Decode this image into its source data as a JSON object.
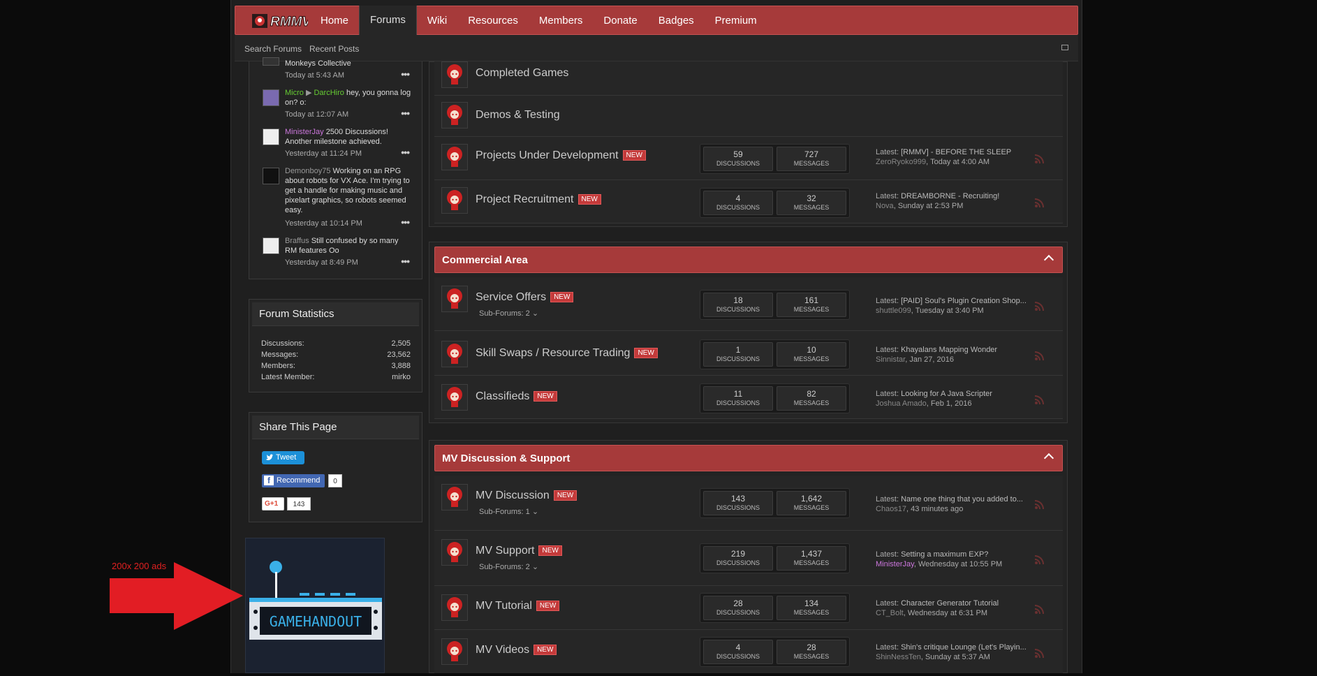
{
  "topnav": {
    "logo_text": "RMMV",
    "items": [
      "Home",
      "Forums",
      "Wiki",
      "Resources",
      "Members",
      "Donate",
      "Badges",
      "Premium"
    ],
    "active": "Forums"
  },
  "subnav": {
    "search": "Search Forums",
    "recent": "Recent Posts"
  },
  "profile_posts": [
    {
      "user": "",
      "target": "",
      "text": "Monkeys Collective",
      "time": "Today at 5:43 AM"
    },
    {
      "user": "Micro",
      "target": "DarcHiro",
      "text": "hey, you gonna log on? o:",
      "time": "Today at 12:07 AM"
    },
    {
      "user": "MinisterJay",
      "target": "",
      "text": "2500 Discussions! Another milestone achieved.",
      "time": "Yesterday at 11:24 PM"
    },
    {
      "user": "Demonboy75",
      "target": "",
      "text": "Working on an RPG about robots for VX Ace. I'm trying to get a handle for making music and pixelart graphics, so robots seemed easy.",
      "time": "Yesterday at 10:14 PM"
    },
    {
      "user": "Braffus",
      "target": "",
      "text": "Still confused by so many RM features Oo",
      "time": "Yesterday at 8:49 PM"
    }
  ],
  "colors": {
    "micro": "#66cc33",
    "darchiro": "#66cc33",
    "ministerjay": "#cc77dd",
    "demonboy": "#999999",
    "braffus": "#999999",
    "accent": "#a63a3a"
  },
  "forum_stats": {
    "title": "Forum Statistics",
    "rows": [
      {
        "label": "Discussions:",
        "value": "2,505"
      },
      {
        "label": "Messages:",
        "value": "23,562"
      },
      {
        "label": "Members:",
        "value": "3,888"
      },
      {
        "label": "Latest Member:",
        "value": "mirko"
      }
    ]
  },
  "share": {
    "title": "Share This Page",
    "tweet": "Tweet",
    "recommend": "Recommend",
    "recommend_count": "0",
    "gplus": "G+1",
    "gplus_count": "143"
  },
  "ad": {
    "text": "GAMEHANDOUT",
    "annotation": "200x 200 ads"
  },
  "labels": {
    "discussions": "DISCUSSIONS",
    "messages": "MESSAGES",
    "new": "NEW",
    "latest": "Latest:"
  },
  "top_forums": [
    {
      "title": "Completed Games"
    },
    {
      "title": "Demos & Testing"
    },
    {
      "title": "Projects Under Development",
      "new": true,
      "discussions": "59",
      "messages": "727",
      "latest": "[RMMV] - BEFORE THE SLEEP",
      "author": "ZeroRyoko999",
      "when": "Today at 4:00 AM"
    },
    {
      "title": "Project Recruitment",
      "new": true,
      "discussions": "4",
      "messages": "32",
      "latest": "DREAMBORNE - Recruiting!",
      "author": "Nova",
      "when": "Sunday at 2:53 PM"
    }
  ],
  "commercial": {
    "title": "Commercial Area",
    "forums": [
      {
        "title": "Service Offers",
        "new": true,
        "sub": "Sub-Forums: 2",
        "discussions": "18",
        "messages": "161",
        "latest": "[PAID] Soul's Plugin Creation Shop...",
        "author": "shuttle099",
        "when": "Tuesday at 3:40 PM"
      },
      {
        "title": "Skill Swaps / Resource Trading",
        "new": true,
        "discussions": "1",
        "messages": "10",
        "latest": "Khayalans Mapping Wonder",
        "author": "Sinnistar",
        "when": "Jan 27, 2016"
      },
      {
        "title": "Classifieds",
        "new": true,
        "discussions": "11",
        "messages": "82",
        "latest": "Looking for A Java Scripter",
        "author": "Joshua Amado",
        "when": "Feb 1, 2016"
      }
    ]
  },
  "mv": {
    "title": "MV Discussion & Support",
    "forums": [
      {
        "title": "MV Discussion",
        "new": true,
        "sub": "Sub-Forums: 1",
        "discussions": "143",
        "messages": "1,642",
        "latest": "Name one thing that you added to...",
        "author": "Chaos17",
        "when": "43 minutes ago"
      },
      {
        "title": "MV Support",
        "new": true,
        "sub": "Sub-Forums: 2",
        "discussions": "219",
        "messages": "1,437",
        "latest": "Setting a maximum EXP?",
        "author": "MinisterJay",
        "when": "Wednesday at 10:55 PM"
      },
      {
        "title": "MV Tutorial",
        "new": true,
        "discussions": "28",
        "messages": "134",
        "latest": "Character Generator Tutorial",
        "author": "CT_Bolt",
        "when": "Wednesday at 6:31 PM"
      },
      {
        "title": "MV Videos",
        "new": true,
        "discussions": "4",
        "messages": "28",
        "latest": "Shin's critique Lounge (Let's Playin...",
        "author": "ShinNessTen",
        "when": "Sunday at 5:37 AM"
      }
    ]
  }
}
